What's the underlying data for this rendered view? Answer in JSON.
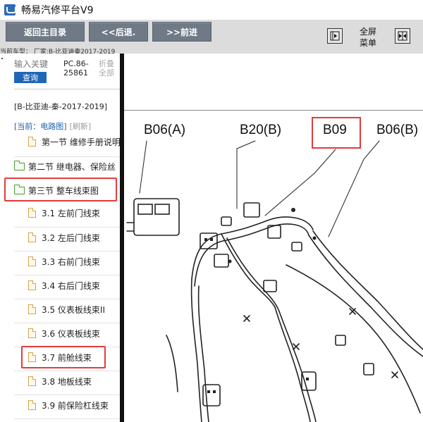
{
  "window": {
    "title": "畅易汽修平台V9",
    "icon": "app-logo-icon"
  },
  "toolbar": {
    "back_main": "返回主目录",
    "back": "<<后退.",
    "forward": ">>前进",
    "fullscreen_line1": "全屏",
    "fullscreen_line2": "菜单",
    "left_icon": "expand-right-icon",
    "right_icon": "collapse-both-icon"
  },
  "vehicle_bar": "当前车型：  厂家:B-比亚迪秦2017-2019",
  "sidebar": {
    "search_placeholder": "输入关键",
    "search_button": "查询",
    "pc_code": "PC.86-25861",
    "fold_label": "折叠全部",
    "vehicle_name": "[B-比亚迪-秦-2017-2019]",
    "crumb_current": "[当前：电路图]",
    "crumb_refresh": "[刷新]",
    "items": [
      {
        "label": "第一节 维修手册说明",
        "type": "doc"
      },
      {
        "label": "第二节 继电器、保险丝",
        "type": "folder"
      },
      {
        "label": "第三节 整车线束图",
        "type": "folder"
      },
      {
        "label": "3.1 左前门线束",
        "type": "doc"
      },
      {
        "label": "3.2 左后门线束",
        "type": "doc"
      },
      {
        "label": "3.3 右前门线束",
        "type": "doc"
      },
      {
        "label": "3.4 右后门线束",
        "type": "doc"
      },
      {
        "label": "3.5 仪表板线束II",
        "type": "doc"
      },
      {
        "label": "3.6 仪表板线束",
        "type": "doc"
      },
      {
        "label": "3.7 前舱线束",
        "type": "doc"
      },
      {
        "label": "3.8 地板线束",
        "type": "doc"
      },
      {
        "label": "3.9 前保险杠线束",
        "type": "doc"
      }
    ]
  },
  "diagram": {
    "labels": [
      "B06(A)",
      "B20(B)",
      "B09",
      "B06(B)"
    ],
    "highlight_color": "#e23b3b"
  }
}
